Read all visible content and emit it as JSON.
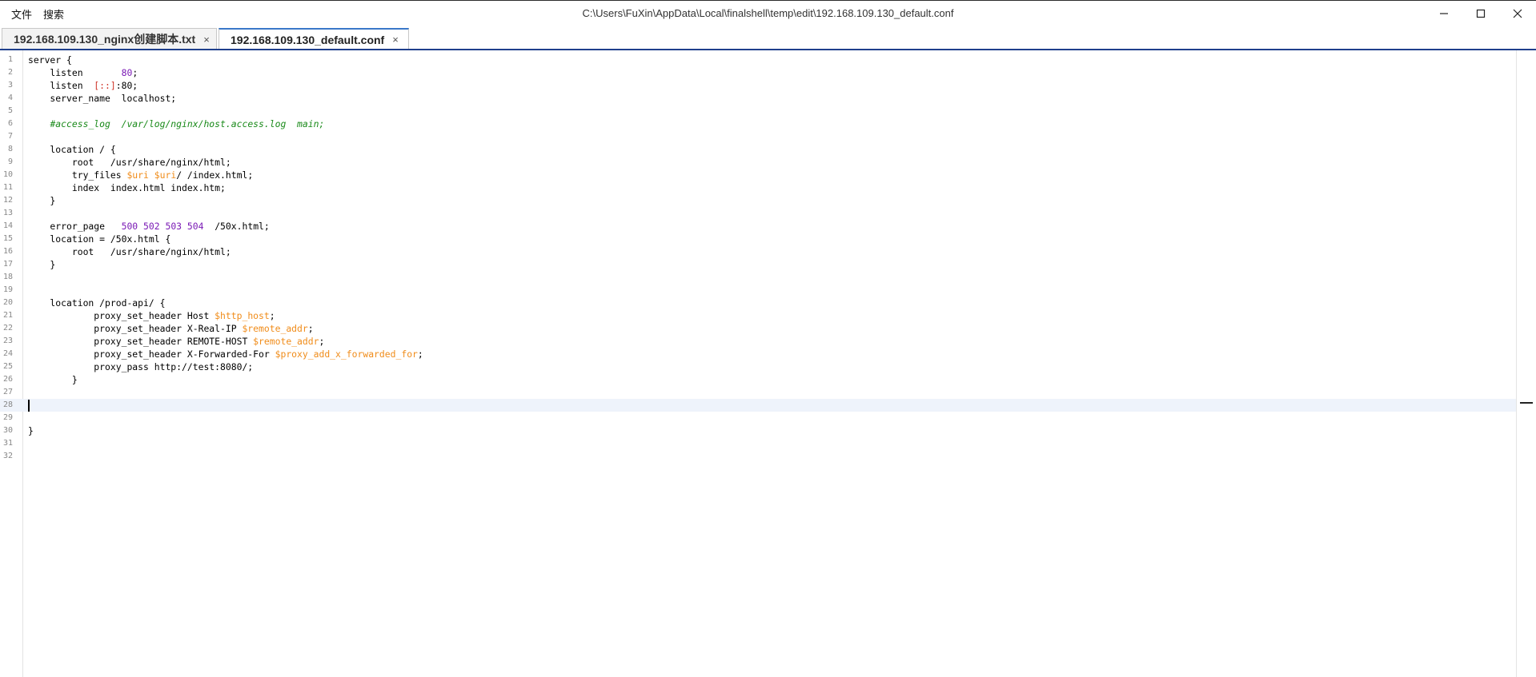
{
  "menu": {
    "file": "文件",
    "search": "搜索"
  },
  "window": {
    "path": "C:\\Users\\FuXin\\AppData\\Local\\finalshell\\temp\\edit\\192.168.109.130_default.conf"
  },
  "tabs": [
    {
      "label": "192.168.109.130_nginx创建脚本.txt",
      "close": "×"
    },
    {
      "label": "192.168.109.130_default.conf",
      "close": "×"
    }
  ],
  "editor": {
    "line_numbers": [
      "1",
      "2",
      "3",
      "4",
      "5",
      "6",
      "7",
      "8",
      "9",
      "10",
      "11",
      "12",
      "13",
      "14",
      "15",
      "16",
      "17",
      "18",
      "19",
      "20",
      "21",
      "22",
      "23",
      "24",
      "25",
      "26",
      "27",
      "28",
      "29",
      "30",
      "31",
      "32"
    ],
    "current_line": 28,
    "lines": [
      "server {",
      "    listen       80;",
      "    listen  [::]:80;",
      "    server_name  localhost;",
      "",
      "    #access_log  /var/log/nginx/host.access.log  main;",
      "",
      "    location / {",
      "        root   /usr/share/nginx/html;",
      "        try_files $uri $uri/ /index.html;",
      "        index  index.html index.htm;",
      "    }",
      "",
      "    error_page   500 502 503 504  /50x.html;",
      "    location = /50x.html {",
      "        root   /usr/share/nginx/html;",
      "    }",
      "",
      "",
      "    location /prod-api/ {",
      "            proxy_set_header Host $http_host;",
      "            proxy_set_header X-Real-IP $remote_addr;",
      "            proxy_set_header REMOTE-HOST $remote_addr;",
      "            proxy_set_header X-Forwarded-For $proxy_add_x_forwarded_for;",
      "            proxy_pass http://test:8080/;",
      "        }",
      "",
      "",
      "",
      "}",
      "",
      ""
    ]
  },
  "colors": {
    "number": "#7a1ab5",
    "bracket": "#d0362b",
    "variable": "#f08c1a",
    "comment": "#1a8a1a",
    "tab_accent": "#3a78c9",
    "current_line_bg": "#eef3fb"
  }
}
